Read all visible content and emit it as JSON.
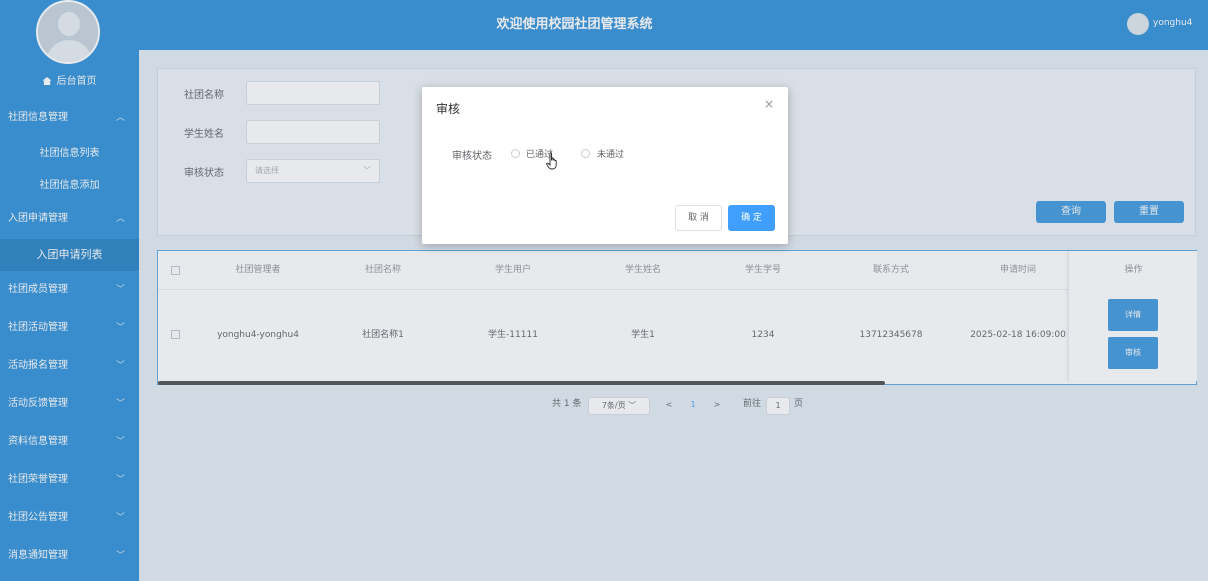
{
  "header": {
    "title": "欢迎使用校园社团管理系统",
    "username": "yonghu4"
  },
  "sidebar": {
    "home": "后台首页",
    "menus": [
      {
        "label": "社团信息管理",
        "expanded": true,
        "children": [
          "社团信息列表",
          "社团信息添加"
        ]
      },
      {
        "label": "入团申请管理",
        "expanded": true,
        "children": [
          "入团申请列表"
        ]
      },
      {
        "label": "社团成员管理"
      },
      {
        "label": "社团活动管理"
      },
      {
        "label": "活动报名管理"
      },
      {
        "label": "活动反馈管理"
      },
      {
        "label": "资料信息管理"
      },
      {
        "label": "社团荣誉管理"
      },
      {
        "label": "社团公告管理"
      },
      {
        "label": "消息通知管理"
      }
    ],
    "active": "入团申请列表"
  },
  "search": {
    "club_name_label": "社团名称",
    "student_name_label": "学生姓名",
    "status_label": "审核状态",
    "status_placeholder": "请选择",
    "query_button": "查询",
    "reset_button": "重置"
  },
  "table": {
    "columns": [
      "社团管理者",
      "社团名称",
      "学生用户",
      "学生姓名",
      "学生学号",
      "联系方式",
      "申请时间",
      "操作"
    ],
    "rows": [
      {
        "manager": "yonghu4-yonghu4",
        "club_name": "社团名称1",
        "student_user": "学生-11111",
        "student_name": "学生1",
        "student_no": "1234",
        "phone": "13712345678",
        "apply_time": "2025-02-18 16:09:00",
        "detail_button": "详情",
        "audit_button": "审核"
      }
    ]
  },
  "pagination": {
    "total": "共 1 条",
    "page_size": "7条/页",
    "prev": "<",
    "current": "1",
    "next": ">",
    "goto_label": "前往",
    "goto_value": "1",
    "page_suffix": "页"
  },
  "dialog": {
    "title": "审核",
    "close_symbol": "×",
    "field_label": "审核状态",
    "options": [
      "已通过",
      "未通过"
    ],
    "cancel_button": "取 消",
    "confirm_button": "确 定"
  },
  "colors": {
    "primary": "#2b8fd8",
    "button": "#3a97dd",
    "confirm": "#409eff"
  },
  "icons": [
    "home-icon",
    "chevron-icon",
    "close-icon",
    "hand-pointer-icon"
  ]
}
